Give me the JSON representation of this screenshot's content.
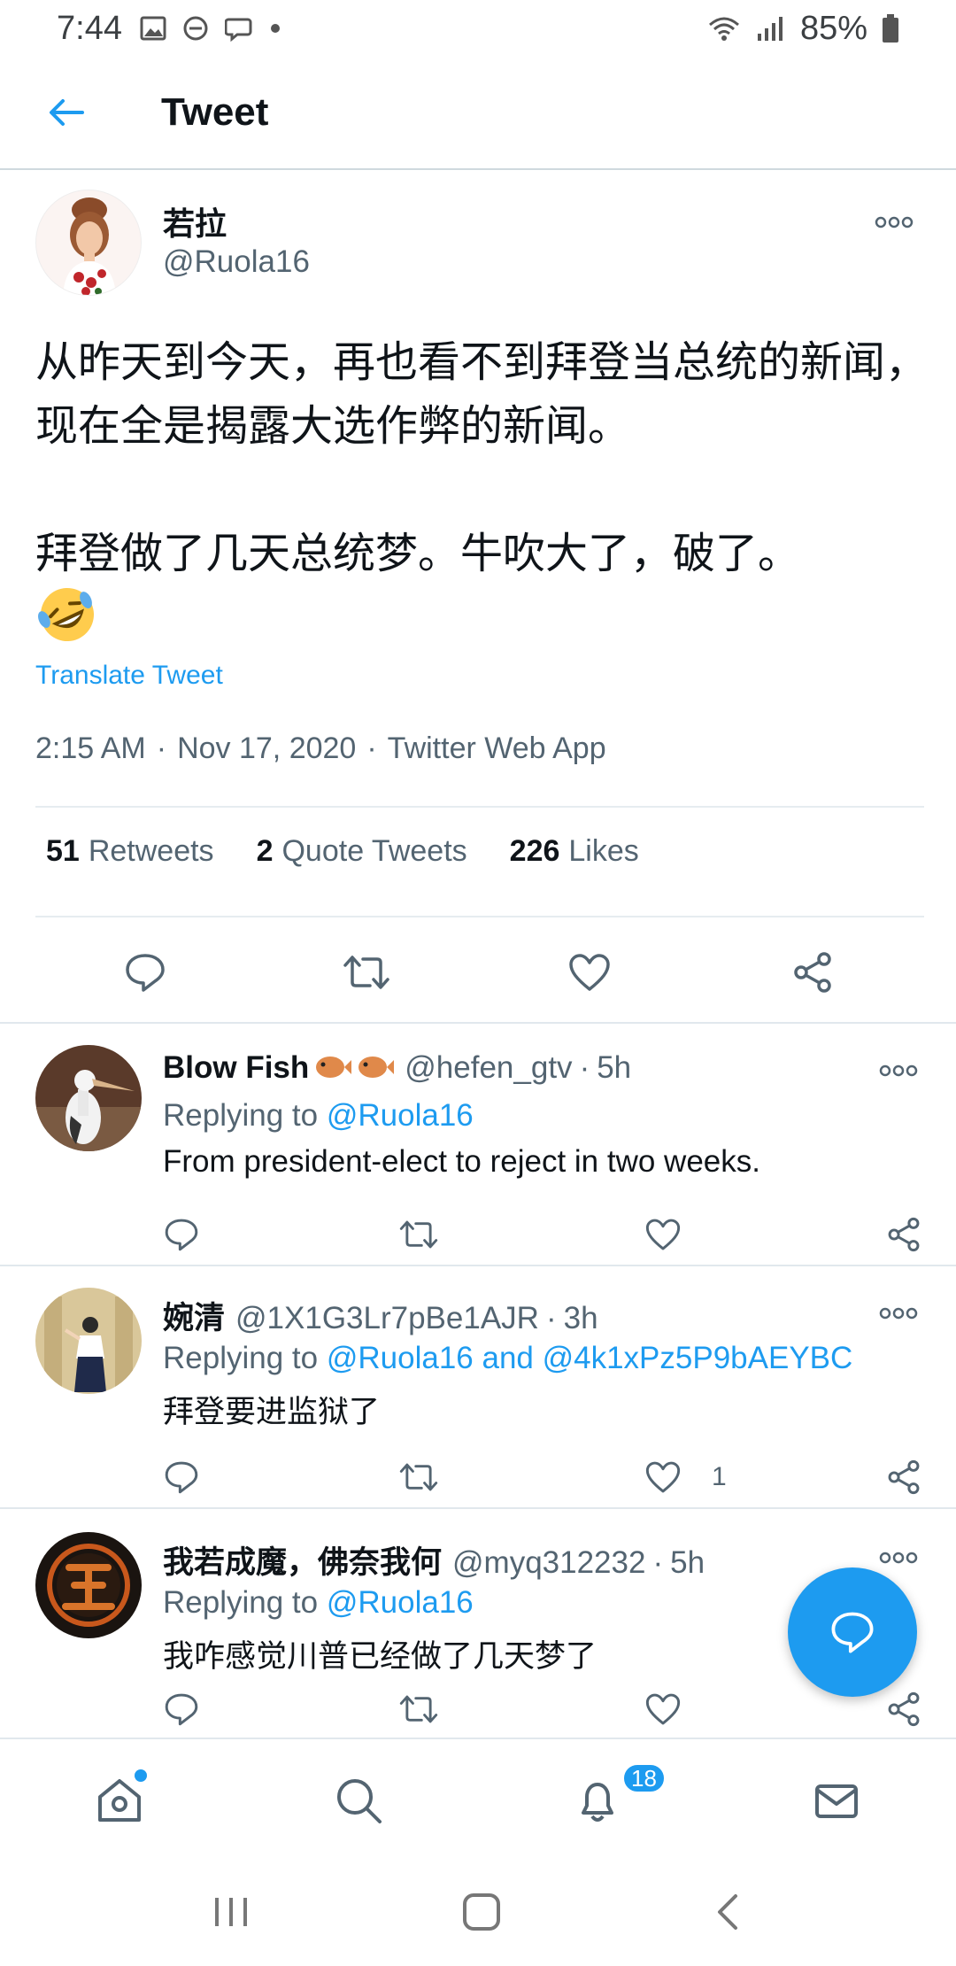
{
  "status_bar": {
    "time": "7:44",
    "battery": "85%"
  },
  "header": {
    "title": "Tweet"
  },
  "tweet": {
    "author_name": "若拉",
    "author_handle": "@Ruola16",
    "text": "从昨天到今天，再也看不到拜登当总统的新闻，现在全是揭露大选作弊的新闻。\n\n拜登做了几天总统梦。牛吹大了，破了。",
    "emoji": "rolling-on-floor-laughing",
    "translate_label": "Translate Tweet",
    "time": "2:15 AM",
    "date": "Nov 17, 2020",
    "source": "Twitter Web App",
    "retweets_count": "51",
    "retweets_label": "Retweets",
    "quotes_count": "2",
    "quotes_label": "Quote Tweets",
    "likes_count": "226",
    "likes_label": "Likes"
  },
  "replies": [
    {
      "name": "Blow Fish",
      "handle": "@hefen_gtv",
      "time": "5h",
      "replying_prefix": "Replying to",
      "mentions": "@Ruola16",
      "text": "From president-elect to reject in two weeks.",
      "like_count": ""
    },
    {
      "name": "婉清",
      "handle": "@1X1G3Lr7pBe1AJR",
      "time": "3h",
      "replying_prefix": "Replying to",
      "mentions": "@Ruola16 and @4k1xPz5P9bAEYBC",
      "text": "拜登要进监狱了",
      "like_count": "1"
    },
    {
      "name": "我若成魔，佛奈我何",
      "handle": "@myq312232",
      "time": "5h",
      "replying_prefix": "Replying to",
      "mentions": "@Ruola16",
      "text": "我咋感觉川普已经做了几天梦了",
      "like_count": ""
    }
  ],
  "bottom_nav": {
    "notifications_badge": "18"
  },
  "colors": {
    "accent": "#1d9bf0",
    "secondary_text": "#536471",
    "primary_text": "#0f1419"
  },
  "icons": [
    "back-arrow-icon",
    "more-icon",
    "reply-icon",
    "retweet-icon",
    "like-icon",
    "share-icon",
    "compose-icon",
    "home-icon",
    "search-icon",
    "bell-icon",
    "mail-icon"
  ]
}
